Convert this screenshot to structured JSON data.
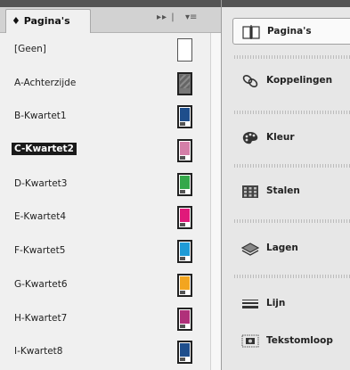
{
  "pages_panel": {
    "tab_label": "♦ Pagina's",
    "controls": "▸▸ |",
    "menu_icon": "▾≡",
    "pages": [
      {
        "name": "[Geen]",
        "thumb": "empty",
        "color": "#ffffff"
      },
      {
        "name": "A-Achterzijde",
        "thumb": "grey",
        "color": "#777777"
      },
      {
        "name": "B-Kwartet1",
        "thumb": "color",
        "color": "#1e4e8c"
      },
      {
        "name": "C-Kwartet2",
        "thumb": "color",
        "color": "#d47fa8",
        "selected": true
      },
      {
        "name": "D-Kwartet3",
        "thumb": "color",
        "color": "#34a84a"
      },
      {
        "name": "E-Kwartet4",
        "thumb": "color",
        "color": "#e0197a"
      },
      {
        "name": "F-Kwartet5",
        "thumb": "color",
        "color": "#1f9bd6"
      },
      {
        "name": "G-Kwartet6",
        "thumb": "color",
        "color": "#f3a51f"
      },
      {
        "name": "H-Kwartet7",
        "thumb": "color",
        "color": "#b0307a"
      },
      {
        "name": "I-Kwartet8",
        "thumb": "color",
        "color": "#1e4e8c"
      }
    ]
  },
  "dock": {
    "items": [
      {
        "label": "Pagina's",
        "icon": "pages-icon",
        "active": true
      },
      {
        "label": "Koppelingen",
        "icon": "links-icon"
      },
      {
        "label": "Kleur",
        "icon": "palette-icon"
      },
      {
        "label": "Stalen",
        "icon": "swatches-icon"
      },
      {
        "label": "Lagen",
        "icon": "layers-icon"
      },
      {
        "label": "Lijn",
        "icon": "stroke-icon"
      },
      {
        "label": "Tekstomloop",
        "icon": "text-wrap-icon"
      }
    ]
  }
}
